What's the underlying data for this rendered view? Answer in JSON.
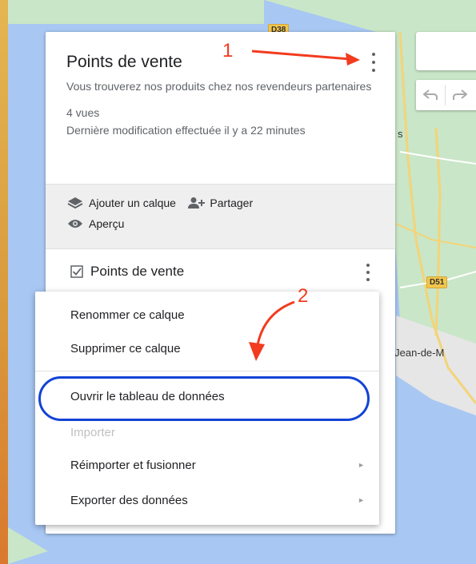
{
  "map": {
    "road_labels": [
      "D38",
      "D51"
    ],
    "place_labels": [
      "s",
      "nt-Jean-de-M"
    ],
    "colors": {
      "water": "#a8c7f3",
      "land": "#c9e6c8",
      "urban": "#e8e8e8",
      "road": "#f5d77a"
    }
  },
  "panel": {
    "title": "Points de vente",
    "description": "Vous trouverez nos produits chez nos revendeurs partenaires",
    "views": "4 vues",
    "last_modified": "Dernière modification effectuée il y a 22 minutes",
    "actions": {
      "add_layer": "Ajouter un calque",
      "share": "Partager",
      "preview": "Aperçu"
    },
    "layer": {
      "name": "Points de vente",
      "checked": true
    }
  },
  "menu": {
    "items": [
      {
        "label": "Renommer ce calque",
        "enabled": true
      },
      {
        "label": "Supprimer ce calque",
        "enabled": true
      },
      {
        "label": "Ouvrir le tableau de données",
        "enabled": true,
        "highlighted": true
      },
      {
        "label": "Importer",
        "enabled": false
      },
      {
        "label": "Réimporter et fusionner",
        "enabled": true,
        "submenu": true
      },
      {
        "label": "Exporter des données",
        "enabled": true,
        "submenu": true
      }
    ],
    "submenu_arrow": "►"
  },
  "annotations": {
    "step1": "1",
    "step2": "2",
    "color": "#f23b1f",
    "highlight_color": "#1343d6"
  },
  "icons": {
    "title_menu": "more-vert-icon",
    "undo": "undo-icon",
    "redo": "redo-icon",
    "layers": "layers-icon",
    "share": "person-add-icon",
    "preview": "eye-icon",
    "checkbox": "checkbox-checked-icon"
  }
}
